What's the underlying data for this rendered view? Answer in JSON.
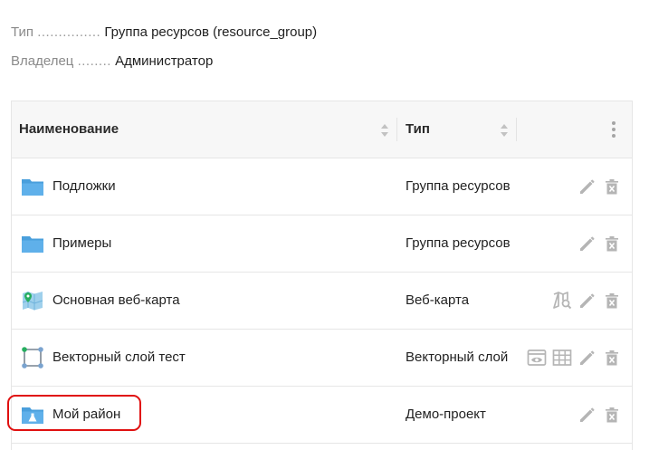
{
  "meta": {
    "type_label": "Тип",
    "type_dots": "...............",
    "type_value": "Группа ресурсов (resource_group)",
    "owner_label": "Владелец",
    "owner_dots": "........",
    "owner_value": "Администратор"
  },
  "table": {
    "columns": [
      "Наименование",
      "Тип"
    ],
    "rows": [
      {
        "name": "Подложки",
        "type": "Группа ресурсов",
        "icon": "folder-icon",
        "actions": [
          "edit-icon",
          "delete-icon"
        ]
      },
      {
        "name": "Примеры",
        "type": "Группа ресурсов",
        "icon": "folder-icon",
        "actions": [
          "edit-icon",
          "delete-icon"
        ]
      },
      {
        "name": "Основная веб-карта",
        "type": "Веб-карта",
        "icon": "webmap-icon",
        "actions": [
          "map-preview-icon",
          "edit-icon",
          "delete-icon"
        ]
      },
      {
        "name": "Векторный слой тест",
        "type": "Векторный слой",
        "icon": "vector-layer-icon",
        "actions": [
          "preview-icon",
          "feature-table-icon",
          "edit-icon",
          "delete-icon"
        ]
      },
      {
        "name": "Мой район",
        "type": "Демо-проект",
        "icon": "demo-project-folder-icon",
        "actions": [
          "edit-icon",
          "delete-icon"
        ]
      }
    ]
  },
  "colors": {
    "highlight": "#e01010",
    "folder": "#4a9fdc",
    "action_icon": "#b5b5b5"
  }
}
